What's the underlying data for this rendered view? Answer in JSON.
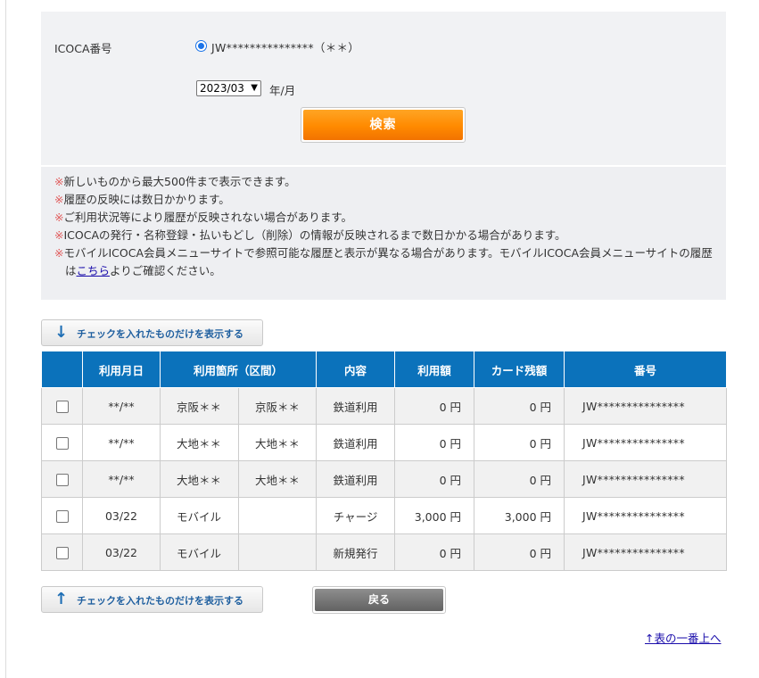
{
  "search": {
    "card_label": "ICOCA番号",
    "card_value": "JW***************（＊＊）",
    "month_selected": "2023/03",
    "month_unit": "年/月",
    "search_button": "検索"
  },
  "notes": [
    {
      "mark": "※",
      "text": "新しいものから最大500件まで表示できます。"
    },
    {
      "mark": "※",
      "text": "履歴の反映には数日かかります。"
    },
    {
      "mark": "※",
      "text": "ご利用状況等により履歴が反映されない場合があります。"
    },
    {
      "mark": "※",
      "text": "ICOCAの発行・名称登録・払いもどし（削除）の情報が反映されるまで数日かかる場合があります。"
    }
  ],
  "note_last": {
    "mark": "※",
    "before": "モバイルICOCA会員メニューサイトで参照可能な履歴と表示が異なる場合があります。モバイルICOCA会員メニューサイトの履歴は",
    "link": "こちら",
    "after": "よりご確認ください。"
  },
  "filter_button": {
    "top_arrow": "↓",
    "bottom_arrow": "↑",
    "label": "チェックを入れたものだけを表示する"
  },
  "table": {
    "headers": [
      "",
      "利用月日",
      "利用箇所（区間）",
      "内容",
      "利用額",
      "カード残額",
      "番号"
    ],
    "rows": [
      {
        "date": "**/**",
        "from": "京阪＊＊",
        "to": "京阪＊＊",
        "kind": "鉄道利用",
        "amount": "0 円",
        "balance": "0 円",
        "card": "JW***************"
      },
      {
        "date": "**/**",
        "from": "大地＊＊",
        "to": "大地＊＊",
        "kind": "鉄道利用",
        "amount": "0 円",
        "balance": "0 円",
        "card": "JW***************"
      },
      {
        "date": "**/**",
        "from": "大地＊＊",
        "to": "大地＊＊",
        "kind": "鉄道利用",
        "amount": "0 円",
        "balance": "0 円",
        "card": "JW***************"
      },
      {
        "date": "03/22",
        "from": "モバイル",
        "to": "",
        "kind": "チャージ",
        "amount": "3,000 円",
        "balance": "3,000 円",
        "card": "JW***************"
      },
      {
        "date": "03/22",
        "from": "モバイル",
        "to": "",
        "kind": "新規発行",
        "amount": "0 円",
        "balance": "0 円",
        "card": "JW***************"
      }
    ]
  },
  "back_button": "戻る",
  "to_top_link": "↑表の一番上へ",
  "colors": {
    "accent_orange": "#ff8a00",
    "table_header_blue": "#0b72bb",
    "panel_gray": "#f1f2f4",
    "note_mark_red": "#e05a5a"
  }
}
